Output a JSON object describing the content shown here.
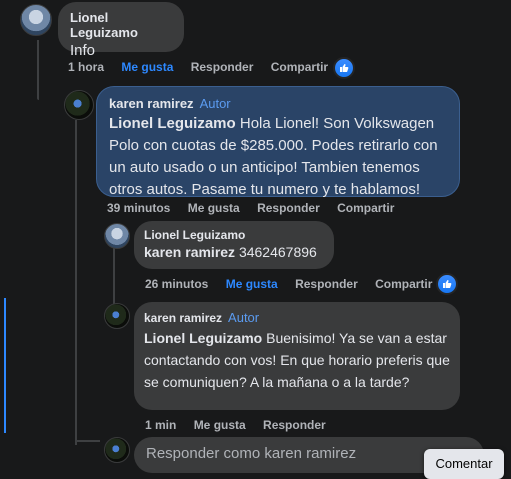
{
  "comments": [
    {
      "author": "Lionel Leguizamo",
      "text": "Info",
      "time": "1 hora",
      "like": "Me gusta",
      "reply": "Responder",
      "share": "Compartir"
    },
    {
      "author": "karen ramirez",
      "badge": "Autor",
      "mention": "Lionel Leguizamo",
      "text": " Hola Lionel! Son Volkswagen Polo con cuotas de $285.000. Podes retirarlo con un auto usado o un anticipo! Tambien tenemos otros autos. Pasame tu numero y te hablamos!",
      "time": "39 minutos",
      "like": "Me gusta",
      "reply": "Responder",
      "share": "Compartir"
    },
    {
      "author": "Lionel Leguizamo",
      "mention": "karen ramirez",
      "text": " 3462467896",
      "time": "26 minutos",
      "like": "Me gusta",
      "reply": "Responder",
      "share": "Compartir"
    },
    {
      "author": "karen ramirez",
      "badge": "Autor",
      "mention": "Lionel Leguizamo",
      "text": " Buenisimo! Ya se van a estar contactando con vos! En que horario preferis que se comuniquen? A la mañana o a la tarde?",
      "time": "1 min",
      "like": "Me gusta",
      "reply": "Responder"
    }
  ],
  "reply_box": {
    "placeholder": "Responder como karen ramirez",
    "submit": "Comentar"
  },
  "colors": {
    "background": "#18191a",
    "bubble": "#3a3b3c",
    "highlight_bubble": "#2a4467",
    "link_blue": "#2d88ff"
  },
  "icons": [
    "avatar",
    "thumbs-up-icon"
  ]
}
